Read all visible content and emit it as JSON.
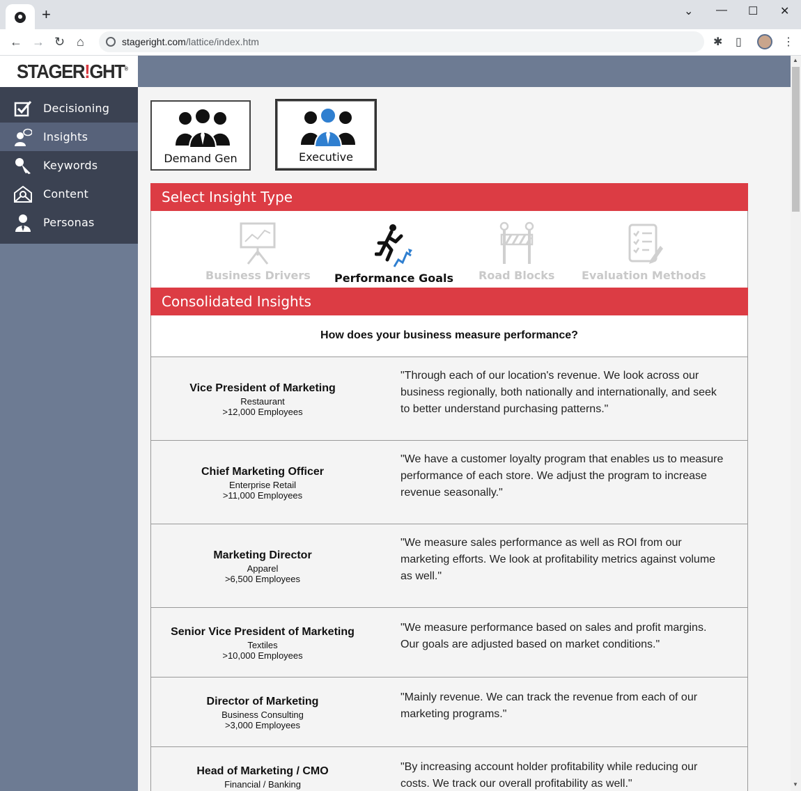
{
  "browser": {
    "url_host": "stageright.com",
    "url_path": "/lattice/index.htm",
    "new_tab": "+",
    "controls": {
      "minimize": "—",
      "maximize": "☐",
      "close": "✕",
      "dropdown": "⌄"
    }
  },
  "app": {
    "logo_main": "STAGER",
    "logo_accent": "!",
    "logo_tail": "GHT",
    "logo_reg": "®"
  },
  "sidebar": {
    "items": [
      {
        "label": "Decisioning",
        "icon": "checkbox-icon"
      },
      {
        "label": "Insights",
        "icon": "speaker-icon",
        "active": true
      },
      {
        "label": "Keywords",
        "icon": "key-icon"
      },
      {
        "label": "Content",
        "icon": "envelope-icon"
      },
      {
        "label": "Personas",
        "icon": "person-icon"
      }
    ]
  },
  "personas": [
    {
      "label": "Demand Gen",
      "selected": false
    },
    {
      "label": "Executive",
      "selected": true
    }
  ],
  "insight_section": {
    "title": "Select Insight Type",
    "types": [
      {
        "label": "Business Drivers",
        "active": false
      },
      {
        "label": "Performance Goals",
        "active": true
      },
      {
        "label": "Road Blocks",
        "active": false
      },
      {
        "label": "Evaluation Methods",
        "active": false
      }
    ]
  },
  "consolidated": {
    "title": "Consolidated Insights",
    "question": "How does your business measure performance?",
    "rows": [
      {
        "role": "Vice President of Marketing",
        "industry": "Restaurant",
        "size": ">12,000 Employees",
        "quote": "\"Through each of our location's revenue. We look across our business regionally, both nationally and internationally, and seek to better understand purchasing patterns.\""
      },
      {
        "role": "Chief Marketing Officer",
        "industry": "Enterprise Retail",
        "size": ">11,000 Employees",
        "quote": "\"We have a customer loyalty program that enables us to measure performance of each store. We adjust the program to increase revenue seasonally.\""
      },
      {
        "role": "Marketing Director",
        "industry": "Apparel",
        "size": ">6,500 Employees",
        "quote": "\"We measure sales performance as well as ROI from our marketing efforts. We look at profitability metrics against volume as well.\""
      },
      {
        "role": "Senior Vice President of Marketing",
        "industry": "Textiles",
        "size": ">10,000 Employees",
        "quote": "\"We measure performance based on sales and profit margins. Our goals are adjusted based on market conditions.\""
      },
      {
        "role": "Director of Marketing",
        "industry": "Business Consulting",
        "size": ">3,000 Employees",
        "quote": "\"Mainly revenue. We can track the revenue from each of our marketing programs.\""
      },
      {
        "role": "Head of Marketing / CMO",
        "industry": "Financial / Banking",
        "size": "",
        "quote": "\"By increasing account holder profitability while reducing our costs. We track our overall profitability as well.\""
      }
    ]
  },
  "colors": {
    "accent_red": "#dc3c44",
    "slate": "#6d7b93",
    "dark_nav": "#3b4252",
    "active_blue": "#2f7fd0"
  }
}
